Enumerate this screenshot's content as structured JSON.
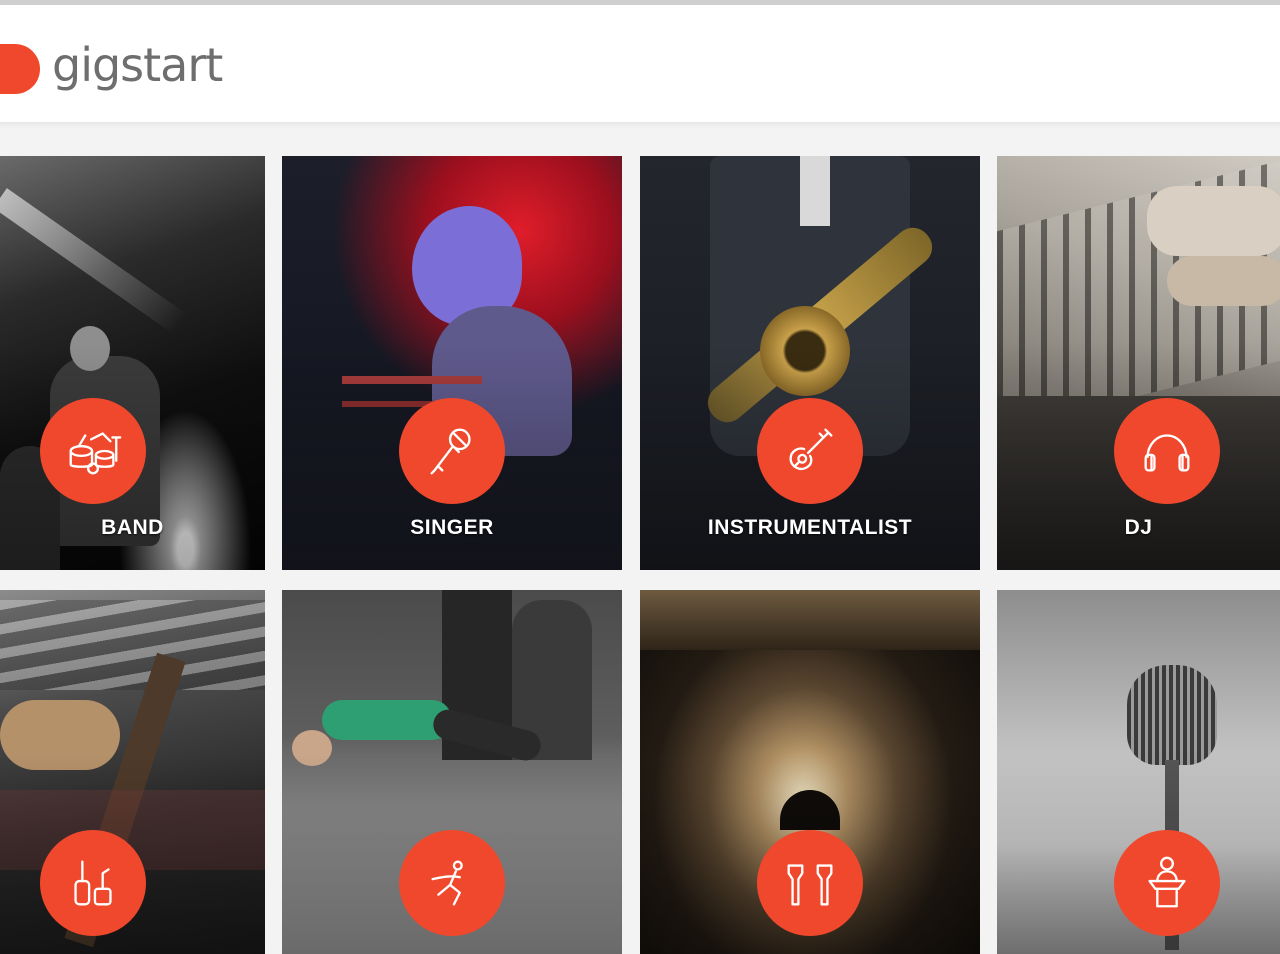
{
  "header": {
    "logo_text": "gigstart"
  },
  "brand": {
    "accent": "#f0482d"
  },
  "categories": [
    {
      "label": "BAND",
      "icon": "drum-kit-icon"
    },
    {
      "label": "SINGER",
      "icon": "microphone-icon"
    },
    {
      "label": "INSTRUMENTALIST",
      "icon": "guitar-icon"
    },
    {
      "label": "DJ",
      "icon": "headphones-icon"
    },
    {
      "label": "",
      "icon": "instruments-icon"
    },
    {
      "label": "",
      "icon": "dancer-icon"
    },
    {
      "label": "",
      "icon": "lights-icon"
    },
    {
      "label": "",
      "icon": "speaker-podium-icon"
    }
  ]
}
